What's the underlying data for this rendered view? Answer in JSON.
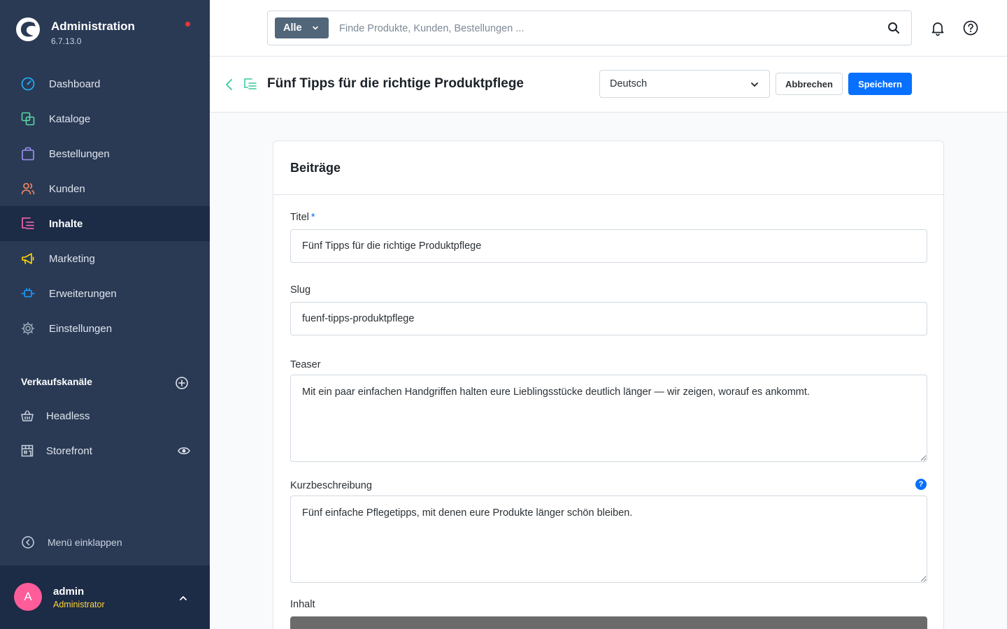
{
  "brand": {
    "title": "Administration",
    "version": "6.7.13.0"
  },
  "nav": {
    "items": [
      {
        "label": "Dashboard",
        "icon": "dashboard-icon",
        "color": "#23b3ff"
      },
      {
        "label": "Kataloge",
        "icon": "catalog-icon",
        "color": "#57d9a3"
      },
      {
        "label": "Bestellungen",
        "icon": "shopping-bag-icon",
        "color": "#a092f0"
      },
      {
        "label": "Kunden",
        "icon": "users-icon",
        "color": "#f88962"
      },
      {
        "label": "Inhalte",
        "icon": "content-icon",
        "color": "#ff68b4",
        "active": true
      },
      {
        "label": "Marketing",
        "icon": "megaphone-icon",
        "color": "#ffd700"
      },
      {
        "label": "Erweiterungen",
        "icon": "plug-icon",
        "color": "#189eff"
      },
      {
        "label": "Einstellungen",
        "icon": "gear-icon",
        "color": "#9aa8b5"
      }
    ]
  },
  "sales_channels": {
    "heading": "Verkaufskanäle",
    "items": [
      {
        "label": "Headless",
        "icon": "basket-icon"
      },
      {
        "label": "Storefront",
        "icon": "storefront-icon"
      }
    ]
  },
  "collapse_menu": "Menü einklappen",
  "user": {
    "initial": "A",
    "name": "admin",
    "role": "Administrator"
  },
  "search": {
    "scope": "Alle",
    "placeholder": "Finde Produkte, Kunden, Bestellungen ..."
  },
  "smartbar": {
    "title": "Fünf Tipps für die richtige Produktpflege",
    "language": "Deutsch",
    "cancel_label": "Abbrechen",
    "save_label": "Speichern"
  },
  "card": {
    "title": "Beiträge",
    "fields": {
      "title_label": "Titel",
      "title_required": "*",
      "title_value": "Fünf Tipps für die richtige Produktpflege",
      "slug_label": "Slug",
      "slug_value": "fuenf-tipps-produktpflege",
      "teaser_label": "Teaser",
      "teaser_value": "Mit ein paar einfachen Handgriffen halten eure Lieblingsstücke deutlich länger — wir zeigen, worauf es ankommt.",
      "short_label": "Kurzbeschreibung",
      "short_help": "?",
      "short_value": "Fünf einfache Pflegetipps, mit denen eure Produkte länger schön bleiben.",
      "content_label": "Inhalt"
    }
  },
  "colors": {
    "sidebar": "#2a3a55",
    "sidebar_active": "#1c2b46",
    "primary": "#0870ff",
    "notification_dot": "#e5363a",
    "avatar": "#ff5c9a",
    "role": "#ffd43b"
  }
}
